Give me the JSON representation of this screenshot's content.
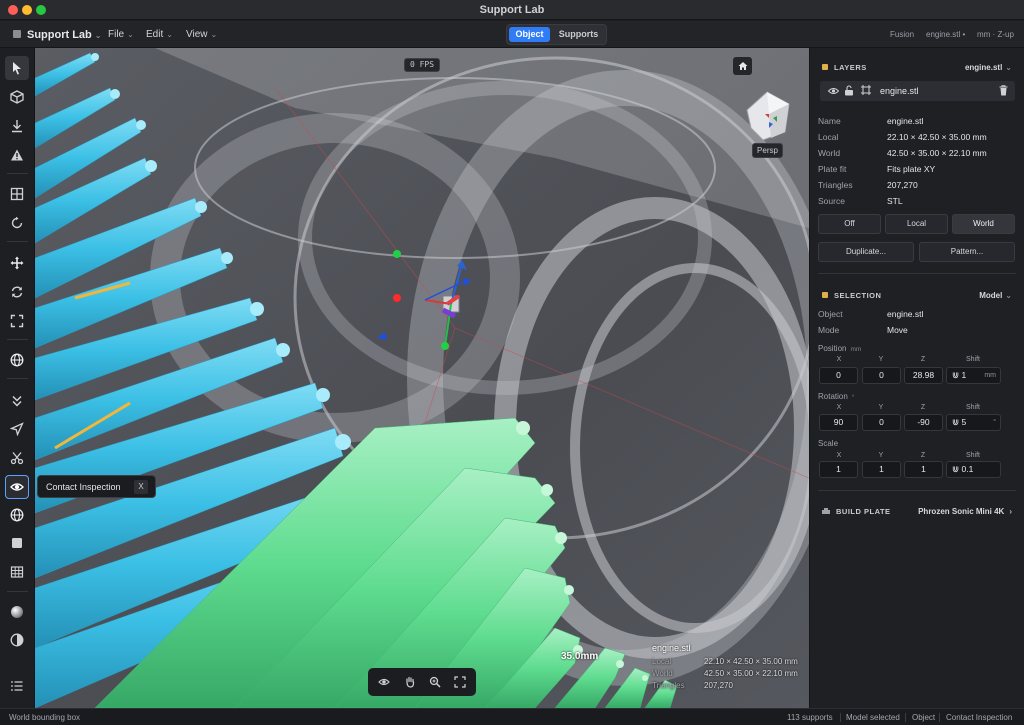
{
  "window": {
    "title": "Support Lab"
  },
  "menubar": {
    "app_name": "Support Lab",
    "menus": [
      "File",
      "Edit",
      "View"
    ],
    "mode_tabs": [
      {
        "label": "Object",
        "active": true
      },
      {
        "label": "Supports",
        "active": false
      }
    ],
    "right": {
      "workspace": "Fusion",
      "file": "engine.stl •",
      "units": "mm · Z-up"
    }
  },
  "toolbar": {
    "tools": [
      "select",
      "cube",
      "import",
      "warning",
      "grid",
      "rotate",
      "move",
      "refresh",
      "fit",
      "globe",
      "chevrons",
      "send",
      "scissors",
      "eye",
      "globe",
      "square",
      "table",
      "sphere",
      "contrast",
      "list"
    ],
    "active": "select",
    "highlighted": "eye"
  },
  "viewport": {
    "fps": "0 FPS",
    "camera_mode": "Persp",
    "tooltip": {
      "label": "Contact Inspection",
      "shortcut": "X"
    },
    "dimension_label": "35.0mm",
    "hud": {
      "name": "engine.stl",
      "rows": [
        {
          "key": "Local",
          "value": "22.10 × 42.50 × 35.00 mm"
        },
        {
          "key": "World",
          "value": "42.50 × 35.00 × 22.10 mm"
        },
        {
          "key": "Triangles",
          "value": "207,270"
        }
      ]
    },
    "nav_tools": [
      "eye-icon",
      "hand-icon",
      "zoom-icon",
      "fullscreen-icon"
    ]
  },
  "layers": {
    "header": "LAYERS",
    "file_dropdown": "engine.stl",
    "item_name": "engine.stl",
    "props": [
      {
        "key": "Name",
        "value": "engine.stl"
      },
      {
        "key": "Local",
        "value": "22.10 × 42.50 × 35.00 mm"
      },
      {
        "key": "World",
        "value": "42.50 × 35.00 × 22.10 mm"
      },
      {
        "key": "Plate fit",
        "value": "Fits plate XY"
      },
      {
        "key": "Triangles",
        "value": "207,270"
      },
      {
        "key": "Source",
        "value": "STL"
      }
    ],
    "bbox_modes": [
      {
        "label": "Off",
        "selected": false
      },
      {
        "label": "Local",
        "selected": false
      },
      {
        "label": "World",
        "selected": true
      }
    ],
    "actions": [
      "Duplicate...",
      "Pattern..."
    ]
  },
  "selection": {
    "header": "SELECTION",
    "mode_dropdown": "Model",
    "props": [
      {
        "key": "Object",
        "value": "engine.stl"
      },
      {
        "key": "Mode",
        "value": "Move"
      }
    ],
    "position": {
      "label": "Position",
      "unit": "mm",
      "axes": [
        "X",
        "Y",
        "Z",
        "Shift"
      ],
      "values": [
        "0",
        "0",
        "28.98"
      ],
      "shift": "1",
      "shift_unit": "mm"
    },
    "rotation": {
      "label": "Rotation",
      "unit": "°",
      "axes": [
        "X",
        "Y",
        "Z",
        "Shift"
      ],
      "values": [
        "90",
        "0",
        "-90"
      ],
      "shift": "5",
      "shift_unit": "°"
    },
    "scale": {
      "label": "Scale",
      "axes": [
        "X",
        "Y",
        "Z",
        "Shift"
      ],
      "values": [
        "1",
        "1",
        "1"
      ],
      "shift": "0.1"
    }
  },
  "build_plate": {
    "header": "BUILD PLATE",
    "printer": "Phrozen Sonic Mini 4K"
  },
  "status": {
    "left": "World bounding box",
    "items": [
      "113 supports",
      "Model selected",
      "Object",
      "Contact Inspection"
    ]
  },
  "colors": {
    "accent": "#2f7cf6",
    "support_blue": "#3cc0e6",
    "support_green": "#5fdc8f",
    "lock": "#e2b04a"
  }
}
